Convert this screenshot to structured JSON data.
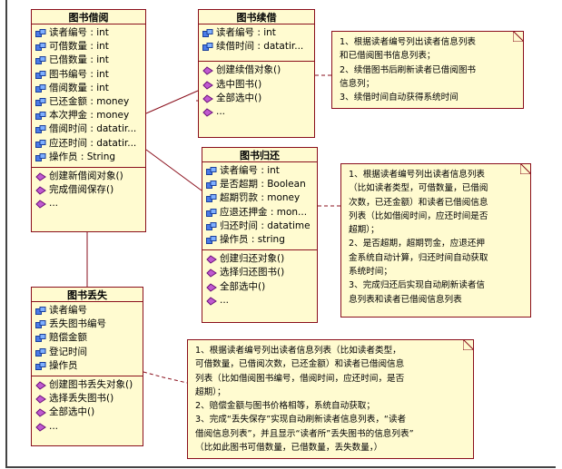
{
  "classes": {
    "borrow": {
      "title": "图书借阅",
      "attributes": [
        "读者编号 : int",
        "可借数量 : int",
        "已借数量 : int",
        "图书编号 : int",
        "借阅数量 : int",
        "已还金额 : money",
        "本次押金 : money",
        "借阅时间 : datatir...",
        "应还时间 : datatir...",
        "操作员 : String"
      ],
      "operations": [
        "创建新借阅对象()",
        "完成借阅保存()",
        "..."
      ]
    },
    "renew": {
      "title": "图书续借",
      "attributes": [
        "读者编号 : int",
        "续借时间 : datatir..."
      ],
      "operations": [
        "创建续借对象()",
        "选中图书()",
        "全部选中()",
        "..."
      ]
    },
    "return": {
      "title": "图书归还",
      "attributes": [
        "读者编号 : int",
        "是否超期 : Boolean",
        "超期罚款 : money",
        "应退还押金 : mon...",
        "归还时间 : datatime",
        "操作员 : string"
      ],
      "operations": [
        "创建归还对象()",
        "选择归还图书()",
        "全部选中()",
        "..."
      ]
    },
    "lost": {
      "title": "图书丢失",
      "attributes": [
        "读者编号",
        "丢失图书编号",
        "赔偿金额",
        "登记时间",
        "操作员"
      ],
      "operations": [
        "创建图书丢失对象()",
        "选择丢失图书()",
        "全部选中()",
        "..."
      ]
    }
  },
  "notes": {
    "renew_note": [
      "1、根据读者编号列出读者信息列表",
      "和已借阅图书信息列表；",
      "2、续借图书后刷新读者已借阅图书",
      "信息列；",
      "3、续借时间自动获得系统时间"
    ],
    "return_note": [
      "1、根据读者编号列出读者信息列表",
      "（比如读者类型，可借数量，已借阅",
      "次数，已还金额）和读者已借阅信息",
      "列表（比如借阅时间，应还时间是否",
      "超期）；",
      "2、是否超期，超期罚金，应退还押",
      "金系统自动计算，归还时间自动获取",
      "系统时间；",
      "3、完成归还后实现自动刷新读者信",
      "息列表和读者已借阅信息列表"
    ],
    "lost_note": [
      "1、根据读者编号列出读者信息列表（比如读者类型，",
      "可借数量，已借阅次数，已还金额）和读者已借阅信息",
      "列表（比如借阅图书编号，借阅时间，应还时间，是否",
      "超期）；",
      "2、赔偿金额与图书价格相等，系统自动获取；",
      "3、完成“丢失保存”实现自动刷新读者信息列表，“读者",
      "借阅信息列表”，并且显示“读者所”丢失图书的信息列表”",
      "（比如此图书可借数量，已借数量，丢失数量，）"
    ]
  },
  "colors": {
    "box_fill": "#fffbd0",
    "border": "#8a0f1c",
    "attr_icon": "#2b55c8",
    "op_icon": "#8a1a9a"
  }
}
